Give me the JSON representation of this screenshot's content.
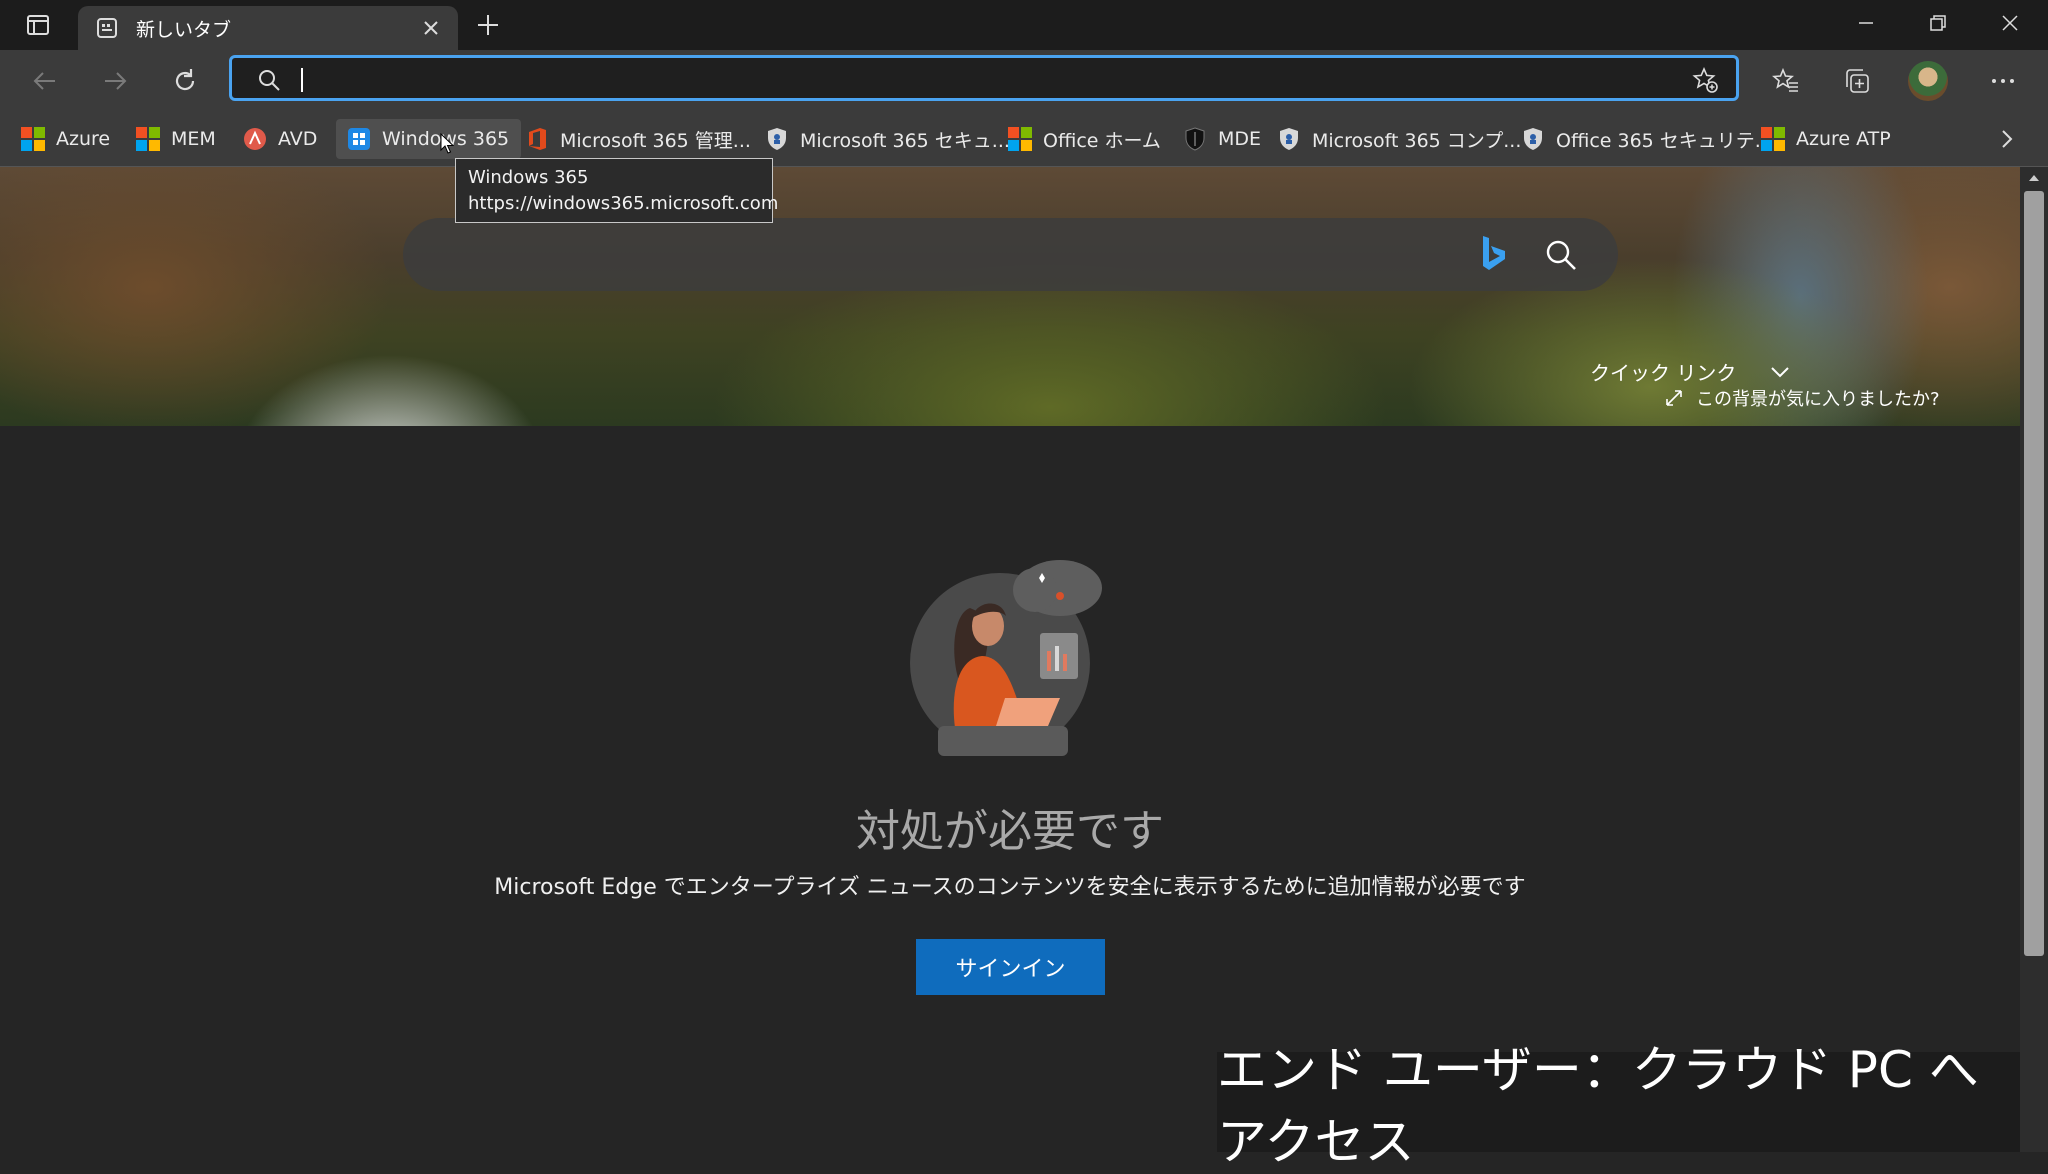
{
  "tab": {
    "title": "新しいタブ"
  },
  "address_bar": {
    "value": "",
    "placeholder": ""
  },
  "favorites": [
    {
      "label": "Azure",
      "icon": "microsoft-logo-icon"
    },
    {
      "label": "MEM",
      "icon": "microsoft-logo-icon"
    },
    {
      "label": "AVD",
      "icon": "avd-icon"
    },
    {
      "label": "Windows 365",
      "icon": "windows-365-icon"
    },
    {
      "label": "Microsoft 365 管理...",
      "icon": "office-icon"
    },
    {
      "label": "Microsoft 365 セキュ...",
      "icon": "security-shield-icon"
    },
    {
      "label": "Office ホーム",
      "icon": "microsoft-logo-icon"
    },
    {
      "label": "MDE",
      "icon": "defender-shield-icon"
    },
    {
      "label": "Microsoft 365 コンプ...",
      "icon": "security-shield-icon"
    },
    {
      "label": "Office 365 セキュリテ...",
      "icon": "security-shield-icon"
    },
    {
      "label": "Azure ATP",
      "icon": "microsoft-logo-icon"
    }
  ],
  "tooltip": {
    "title": "Windows 365",
    "url": "https://windows365.microsoft.com"
  },
  "hero": {
    "search_placeholder": "",
    "quick_links": "クイック リンク",
    "like_background": "この背景が気に入りましたか?"
  },
  "main": {
    "heading": "対処が必要です",
    "subtext": "Microsoft Edge でエンタープライズ ニュースのコンテンツを安全に表示するために追加情報が必要です",
    "signin": "サインイン"
  },
  "caption": "エンド ユーザー：クラウド PC へアクセス",
  "colors": {
    "accent": "#0f6cbd",
    "address_border": "#4aa3f0",
    "chrome": "#3b3b3b",
    "page_bg": "#252525"
  }
}
